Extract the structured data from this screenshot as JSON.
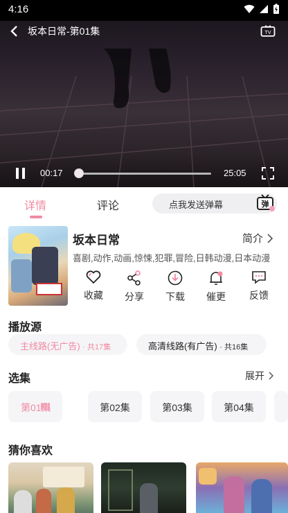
{
  "status_bar": {
    "time": "4:16"
  },
  "player": {
    "title": "坂本日常-第01集",
    "current_time": "00:17",
    "total_time": "25:05",
    "progress": 0.011
  },
  "tabs": {
    "detail": "详情",
    "comment": "评论"
  },
  "danmu": {
    "placeholder": "点我发送弹幕",
    "icon_label": "弹"
  },
  "anime": {
    "title": "坂本日常",
    "intro_label": "简介",
    "tags": "喜剧,动作,动画,惊悚,犯罪,冒险,日韩动漫,日本动漫"
  },
  "actions": [
    {
      "label": "收藏",
      "icon": "heart-icon"
    },
    {
      "label": "分享",
      "icon": "share-icon"
    },
    {
      "label": "下载",
      "icon": "download-icon"
    },
    {
      "label": "催更",
      "icon": "bell-icon"
    },
    {
      "label": "反馈",
      "icon": "feedback-icon"
    }
  ],
  "sources": {
    "title": "播放源",
    "items": [
      {
        "name": "主线路(无广告)",
        "count": "· 共17集",
        "selected": true
      },
      {
        "name": "高清线路(有广告)",
        "count": "· 共16集",
        "selected": false
      }
    ]
  },
  "episodes": {
    "title": "选集",
    "expand_label": "展开",
    "items": [
      "第01集",
      "第02集",
      "第03集",
      "第04集"
    ]
  },
  "recommend": {
    "title": "猜你喜欢"
  },
  "colors": {
    "accent": "#f08aa3",
    "accent_light": "#f5a3b6",
    "chip_bg": "#f5f5f7"
  }
}
